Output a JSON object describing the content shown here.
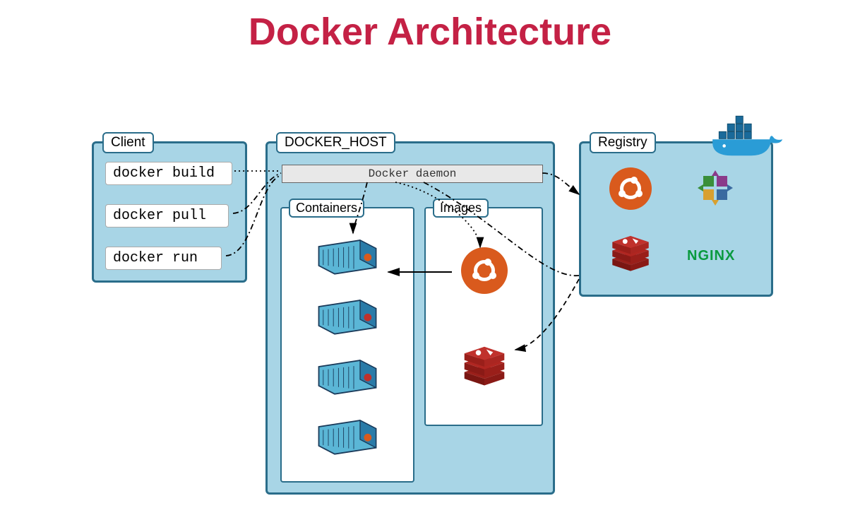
{
  "title": "Docker Architecture",
  "client": {
    "label": "Client",
    "commands": [
      "docker build",
      "docker pull",
      "docker run"
    ]
  },
  "host": {
    "label": "DOCKER_HOST",
    "daemon_label": "Docker daemon",
    "containers_label": "Containers",
    "images_label": "Images"
  },
  "registry": {
    "label": "Registry",
    "nginx_text": "NGINX"
  },
  "icons": {
    "ubuntu": "ubuntu-icon",
    "redis": "redis-icon",
    "centos": "centos-icon",
    "nginx": "nginx-text",
    "docker_whale": "docker-whale-icon",
    "container": "container-icon"
  },
  "connections": [
    {
      "from": "client.docker_build",
      "to": "host.daemon",
      "style": "dotted"
    },
    {
      "from": "client.docker_pull",
      "to": "host.daemon",
      "style": "dash-dot"
    },
    {
      "from": "client.docker_run",
      "to": "host.daemon",
      "style": "dash-dot"
    },
    {
      "from": "host.daemon",
      "to": "images.ubuntu",
      "style": "dotted"
    },
    {
      "from": "host.daemon",
      "to": "containers",
      "style": "dash-dot"
    },
    {
      "from": "host.daemon",
      "to": "registry",
      "style": "dash-dot"
    },
    {
      "from": "registry",
      "to": "images.redis",
      "style": "dashed"
    },
    {
      "from": "images.ubuntu",
      "to": "containers",
      "style": "solid-arrow"
    }
  ]
}
